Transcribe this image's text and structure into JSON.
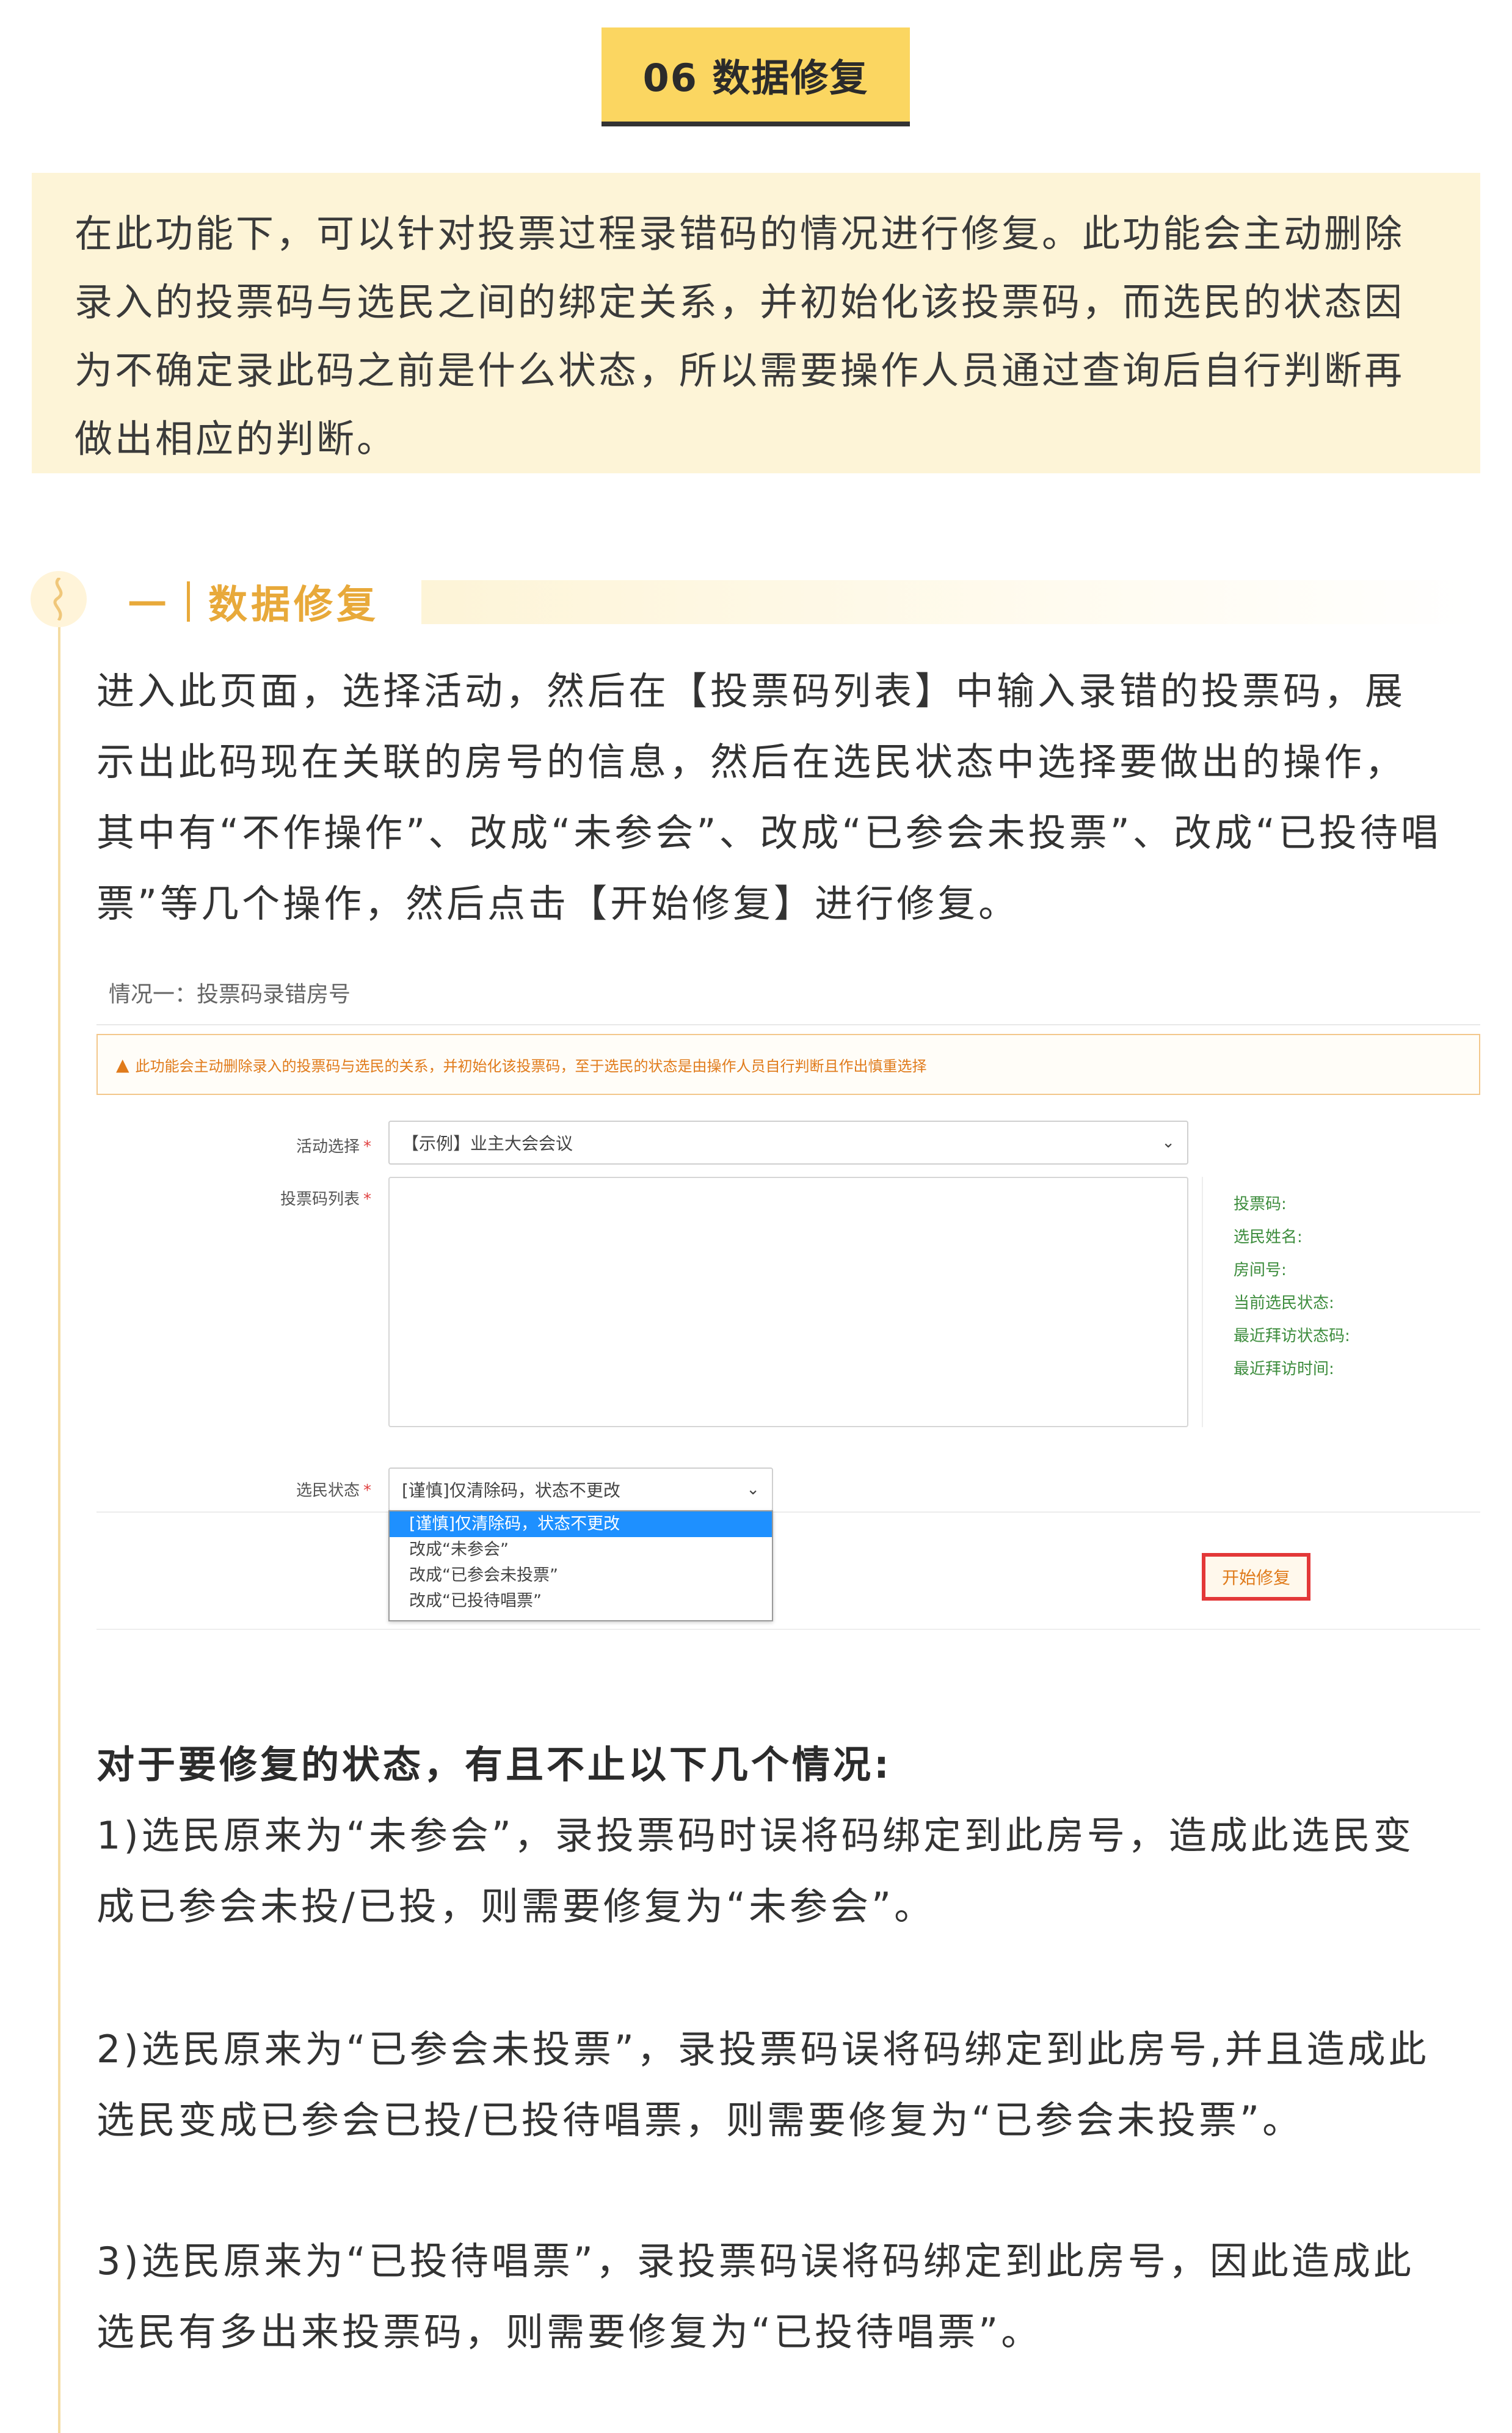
{
  "title_badge": "06 数据修复",
  "intro": {
    "lines": [
      "在此功能下，可以针对投票过程录错码的情况进行修复。此功能会主动删除",
      "录入的投票码与选民之间的绑定关系，并初始化该投票码，而选民的状态因",
      "为不确定录此码之前是什么状态，所以需要操作人员通过查询后自行判断再",
      "做出相应的判断。"
    ]
  },
  "section": {
    "dash": "一",
    "title": "数据修复"
  },
  "paragraph1": {
    "lines": [
      "进入此页面，选择活动，然后在【投票码列表】中输入录错的投票码，展",
      "示出此码现在关联的房号的信息，然后在选民状态中选择要做出的操作，",
      "其中有“不作操作”、改成“未参会”、改成“已参会未投票”、改成“已投待唱",
      "票”等几个操作，然后点击【开始修复】进行修复。"
    ]
  },
  "screenshot": {
    "title": "情况一：投票码录错房号",
    "warning": "此功能会主动删除录入的投票码与选民的关系，并初始化该投票码，至于选民的状态是由操作人员自行判断且作出慎重选择",
    "activity_label": "活动选择",
    "activity_value": "【示例】业主大会会议",
    "code_list_label": "投票码列表",
    "info_fields": [
      "投票码:",
      "选民姓名:",
      "房间号:",
      "当前选民状态:",
      "最近拜访状态码:",
      "最近拜访时间:"
    ],
    "voter_status_label": "选民状态",
    "voter_status_value": "[谨慎]仅清除码，状态不更改",
    "dropdown_options": [
      "[谨慎]仅清除码，状态不更改",
      "改成“未参会”",
      "改成“已参会未投票”",
      "改成“已投待唱票”"
    ],
    "repair_button": "开始修复",
    "required_mark": "*"
  },
  "cases": {
    "heading": "对于要修复的状态，有且不止以下几个情况:",
    "case1": [
      "1)选民原来为“未参会”，录投票码时误将码绑定到此房号，造成此选民变",
      "成已参会未投/已投，则需要修复为“未参会”。"
    ],
    "case2": [
      "2)选民原来为“已参会未投票”，录投票码误将码绑定到此房号,并且造成此",
      "选民变成已参会已投/已投待唱票，则需要修复为“已参会未投票”。"
    ],
    "case3": [
      "3)选民原来为“已投待唱票”，录投票码误将码绑定到此房号，因此造成此",
      "选民有多出来投票码，则需要修复为“已投待唱票”。"
    ]
  },
  "colors": {
    "badge": "#fbd661",
    "intro_bg": "#fdf4d7",
    "accent": "#e8a93a",
    "warning": "#e07b1b",
    "highlight_red": "#e33838",
    "info_green": "#3c8c3c"
  }
}
